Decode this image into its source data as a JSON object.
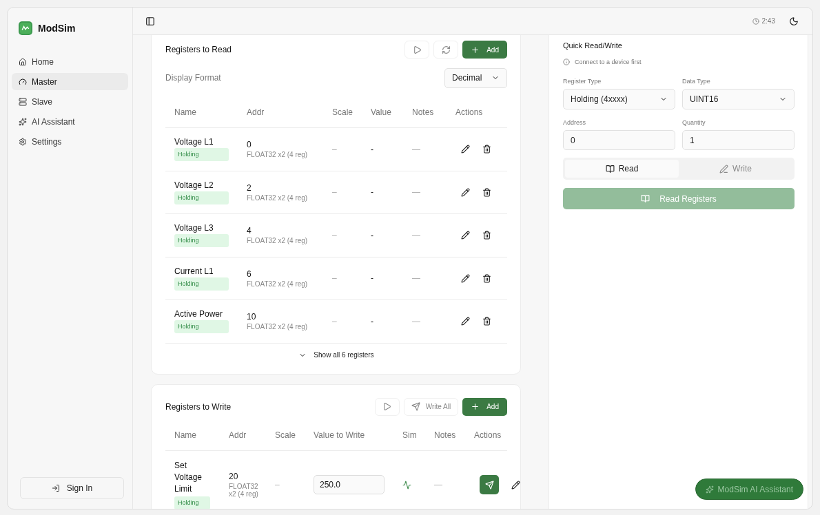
{
  "app": {
    "name": "ModSim"
  },
  "sidebar": {
    "items": [
      {
        "kind": "home",
        "label": "Home",
        "selected": false
      },
      {
        "kind": "master",
        "label": "Master",
        "selected": true
      },
      {
        "kind": "slave",
        "label": "Slave",
        "selected": false
      },
      {
        "kind": "ai",
        "label": "AI Assistant",
        "selected": false
      },
      {
        "kind": "settings",
        "label": "Settings",
        "selected": false
      }
    ],
    "sign_in": "Sign In"
  },
  "header": {
    "clock": "2:43"
  },
  "read_card": {
    "title": "Registers to Read",
    "add": "Add",
    "display_format_label": "Display Format",
    "display_format": "Decimal",
    "columns": [
      "Name",
      "Addr",
      "Scale",
      "Value",
      "Notes",
      "Actions"
    ],
    "rows": [
      {
        "name": "Voltage L1",
        "type": "Holding",
        "addr": "0",
        "format": "FLOAT32 x2 (4 reg)",
        "scale": "–",
        "value": "-",
        "notes": "—"
      },
      {
        "name": "Voltage L2",
        "type": "Holding",
        "addr": "2",
        "format": "FLOAT32 x2 (4 reg)",
        "scale": "–",
        "value": "-",
        "notes": "—"
      },
      {
        "name": "Voltage L3",
        "type": "Holding",
        "addr": "4",
        "format": "FLOAT32 x2 (4 reg)",
        "scale": "–",
        "value": "-",
        "notes": "—"
      },
      {
        "name": "Current L1",
        "type": "Holding",
        "addr": "6",
        "format": "FLOAT32 x2 (4 reg)",
        "scale": "–",
        "value": "-",
        "notes": "—"
      },
      {
        "name": "Active Power",
        "type": "Holding",
        "addr": "10",
        "format": "FLOAT32 x2 (4 reg)",
        "scale": "–",
        "value": "-",
        "notes": "—"
      }
    ],
    "show_all": "Show all 6 registers"
  },
  "write_card": {
    "title": "Registers to Write",
    "write_all": "Write All",
    "add": "Add",
    "columns": [
      "Name",
      "Addr",
      "Scale",
      "Value to Write",
      "Sim",
      "Notes",
      "Actions"
    ],
    "rows": [
      {
        "name": "Set Voltage Limit",
        "type": "Holding",
        "addr": "20",
        "format": "FLOAT32 x2 (4 reg)",
        "scale": "–",
        "value": "250.0",
        "notes": "—"
      }
    ]
  },
  "quick": {
    "title": "Quick Read/Write",
    "notice": "Connect to a device first",
    "register_type_label": "Register Type",
    "register_type": "Holding (4xxxx)",
    "data_type_label": "Data Type",
    "data_type": "UINT16",
    "address_label": "Address",
    "address": "0",
    "quantity_label": "Quantity",
    "quantity": "1",
    "modes": [
      {
        "kind": "read",
        "label": "Read",
        "selected": true
      },
      {
        "kind": "write",
        "label": "Write",
        "selected": false
      }
    ],
    "action": "Read Registers",
    "disabled": true
  },
  "fab": "ModSim AI Assistant"
}
